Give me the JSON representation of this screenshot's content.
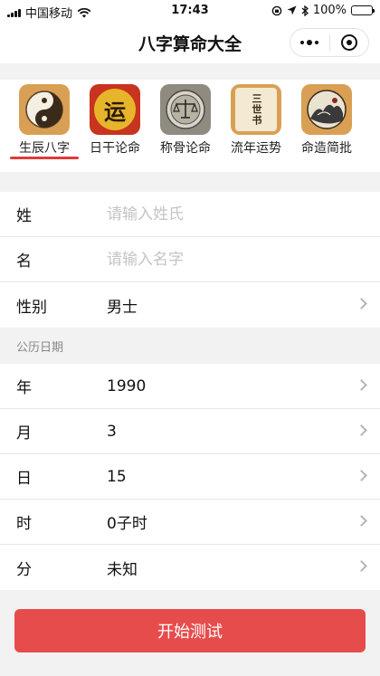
{
  "status": {
    "carrier": "中国移动",
    "time": "17:43",
    "battery": "100%",
    "battery_level": 1.0
  },
  "nav": {
    "title": "八字算命大全"
  },
  "tabs": [
    {
      "label": "生辰八字",
      "icon": "yin-yang-icon",
      "active": true
    },
    {
      "label": "日干论命",
      "icon": "fortune-character-icon",
      "glyph": "运"
    },
    {
      "label": "称骨论命",
      "icon": "scale-icon"
    },
    {
      "label": "流年运势",
      "icon": "scroll-icon",
      "glyph": "三世书"
    },
    {
      "label": "命造简批",
      "icon": "ink-painting-icon"
    }
  ],
  "form": {
    "surname": {
      "label": "姓",
      "placeholder": "请输入姓氏",
      "value": ""
    },
    "given_name": {
      "label": "名",
      "placeholder": "请输入名字",
      "value": ""
    },
    "gender": {
      "label": "性别",
      "value": "男士"
    }
  },
  "calendar": {
    "caption": "公历日期",
    "year": {
      "label": "年",
      "value": "1990"
    },
    "month": {
      "label": "月",
      "value": "3"
    },
    "day": {
      "label": "日",
      "value": "15"
    },
    "hour": {
      "label": "时",
      "value": "0子时"
    },
    "minute": {
      "label": "分",
      "value": "未知"
    }
  },
  "submit_label": "开始测试",
  "colors": {
    "accent": "#e74c4c",
    "underline": "#e03a3a",
    "icon_bg": "#d9a055"
  }
}
